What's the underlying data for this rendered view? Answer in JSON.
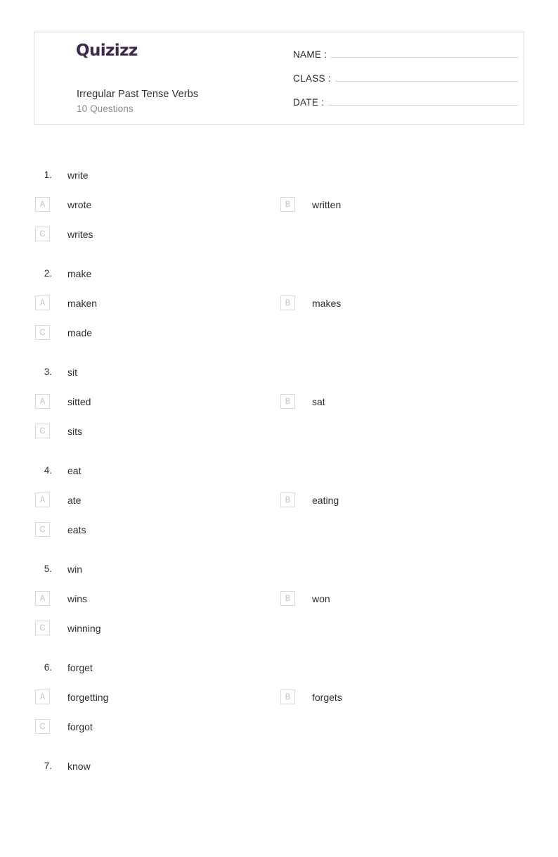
{
  "header": {
    "logo_text": "Quizizz",
    "logo_color": "#3f2a4d",
    "title": "Irregular Past Tense Verbs",
    "subtitle": "10 Questions",
    "fields": [
      {
        "label": "NAME :"
      },
      {
        "label": "CLASS :"
      },
      {
        "label": "DATE  :"
      }
    ]
  },
  "questions": [
    {
      "number": "1.",
      "text": "write",
      "options": [
        {
          "letter": "A",
          "text": "wrote"
        },
        {
          "letter": "B",
          "text": "written"
        },
        {
          "letter": "C",
          "text": "writes"
        }
      ]
    },
    {
      "number": "2.",
      "text": "make",
      "options": [
        {
          "letter": "A",
          "text": "maken"
        },
        {
          "letter": "B",
          "text": "makes"
        },
        {
          "letter": "C",
          "text": "made"
        }
      ]
    },
    {
      "number": "3.",
      "text": "sit",
      "options": [
        {
          "letter": "A",
          "text": "sitted"
        },
        {
          "letter": "B",
          "text": "sat"
        },
        {
          "letter": "C",
          "text": "sits"
        }
      ]
    },
    {
      "number": "4.",
      "text": "eat",
      "options": [
        {
          "letter": "A",
          "text": "ate"
        },
        {
          "letter": "B",
          "text": "eating"
        },
        {
          "letter": "C",
          "text": "eats"
        }
      ]
    },
    {
      "number": "5.",
      "text": "win",
      "options": [
        {
          "letter": "A",
          "text": "wins"
        },
        {
          "letter": "B",
          "text": "won"
        },
        {
          "letter": "C",
          "text": "winning"
        }
      ]
    },
    {
      "number": "6.",
      "text": "forget",
      "options": [
        {
          "letter": "A",
          "text": "forgetting"
        },
        {
          "letter": "B",
          "text": "forgets"
        },
        {
          "letter": "C",
          "text": "forgot"
        }
      ]
    },
    {
      "number": "7.",
      "text": "know",
      "options": []
    }
  ]
}
